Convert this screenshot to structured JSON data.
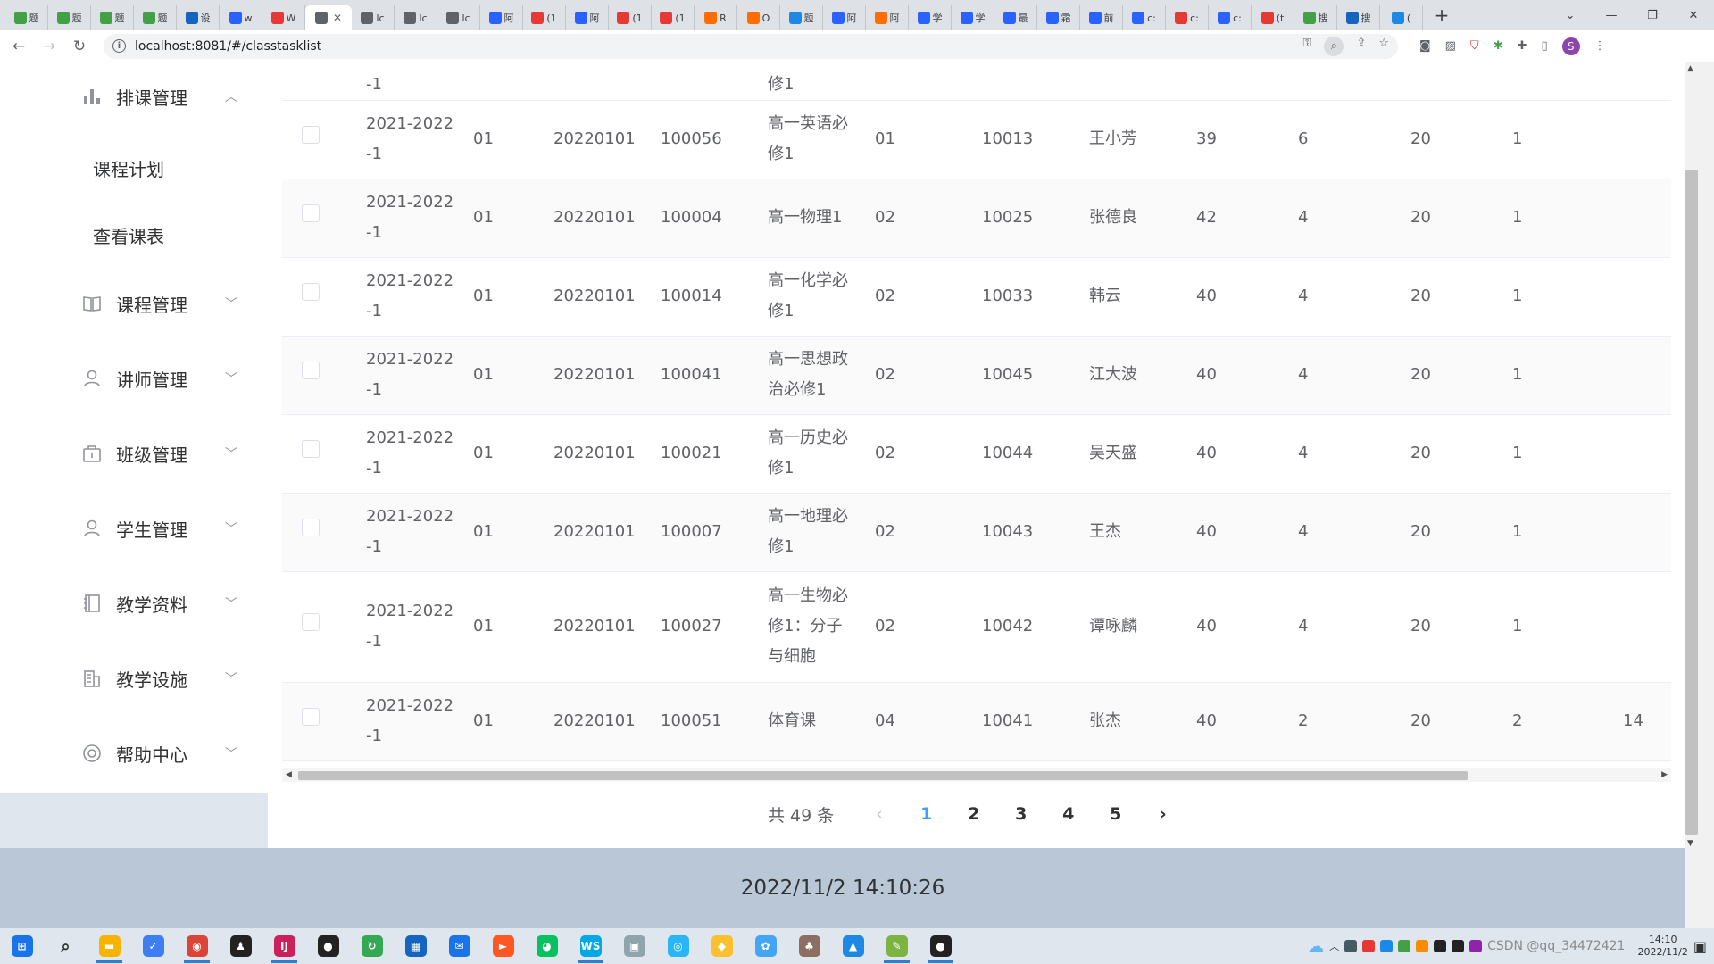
{
  "browser": {
    "tabs": [
      {
        "label": "题",
        "fav": "#43a047"
      },
      {
        "label": "题",
        "fav": "#43a047"
      },
      {
        "label": "题",
        "fav": "#43a047"
      },
      {
        "label": "题",
        "fav": "#43a047"
      },
      {
        "label": "设",
        "fav": "#1565c0"
      },
      {
        "label": "w",
        "fav": "#2962ff"
      },
      {
        "label": "W",
        "fav": "#e53935"
      },
      {
        "label": "",
        "fav": "#5f6368",
        "active": true
      },
      {
        "label": "lc",
        "fav": "#5f6368"
      },
      {
        "label": "lc",
        "fav": "#5f6368"
      },
      {
        "label": "lc",
        "fav": "#5f6368"
      },
      {
        "label": "阿",
        "fav": "#2962ff"
      },
      {
        "label": "(1",
        "fav": "#e53935"
      },
      {
        "label": "阿",
        "fav": "#2962ff"
      },
      {
        "label": "(1",
        "fav": "#e53935"
      },
      {
        "label": "(1",
        "fav": "#e53935"
      },
      {
        "label": "R",
        "fav": "#ff6d00"
      },
      {
        "label": "O",
        "fav": "#ff6d00"
      },
      {
        "label": "题",
        "fav": "#1e88e5"
      },
      {
        "label": "阿",
        "fav": "#2962ff"
      },
      {
        "label": "阿",
        "fav": "#ff6d00"
      },
      {
        "label": "学",
        "fav": "#2962ff"
      },
      {
        "label": "学",
        "fav": "#2962ff"
      },
      {
        "label": "最",
        "fav": "#2962ff"
      },
      {
        "label": "霜",
        "fav": "#2962ff"
      },
      {
        "label": "前",
        "fav": "#2962ff"
      },
      {
        "label": "c:",
        "fav": "#2962ff"
      },
      {
        "label": "c:",
        "fav": "#e53935"
      },
      {
        "label": "c:",
        "fav": "#2962ff"
      },
      {
        "label": "(t",
        "fav": "#e53935"
      },
      {
        "label": "搜",
        "fav": "#43a047"
      },
      {
        "label": "搜",
        "fav": "#1565c0"
      },
      {
        "label": "(",
        "fav": "#1e88e5"
      }
    ],
    "url": "localhost:8081/#/classtasklist",
    "profile_initial": "S"
  },
  "sidebar": {
    "group_open": {
      "label": "排课管理",
      "icon": "bar-chart-icon"
    },
    "subitems": [
      "课程计划",
      "查看课表"
    ],
    "groups": [
      {
        "label": "课程管理",
        "icon": "book-icon",
        "name": "course"
      },
      {
        "label": "讲师管理",
        "icon": "user-icon",
        "name": "teacher"
      },
      {
        "label": "班级管理",
        "icon": "suitcase-icon",
        "name": "class"
      },
      {
        "label": "学生管理",
        "icon": "user-icon",
        "name": "student"
      },
      {
        "label": "教学资料",
        "icon": "notebook-icon",
        "name": "materials"
      },
      {
        "label": "教学设施",
        "icon": "building-icon",
        "name": "facilities"
      },
      {
        "label": "帮助中心",
        "icon": "help-ring-icon",
        "name": "help"
      }
    ]
  },
  "table": {
    "partial_row": {
      "term_tail": "-1",
      "course_tail": "修1"
    },
    "rows": [
      {
        "term": [
          "2021-2022",
          "-1"
        ],
        "c1": "01",
        "c2": "20220101",
        "c3": "100056",
        "course": [
          "高一英语必",
          "修1"
        ],
        "c5": "01",
        "c6": "10013",
        "teacher": "王小芳",
        "c8": "39",
        "c9": "6",
        "c10": "20",
        "c11": "1",
        "c12": ""
      },
      {
        "term": [
          "2021-2022",
          "-1"
        ],
        "c1": "01",
        "c2": "20220101",
        "c3": "100004",
        "course": [
          "高一物理1"
        ],
        "c5": "02",
        "c6": "10025",
        "teacher": "张德良",
        "c8": "42",
        "c9": "4",
        "c10": "20",
        "c11": "1",
        "c12": ""
      },
      {
        "term": [
          "2021-2022",
          "-1"
        ],
        "c1": "01",
        "c2": "20220101",
        "c3": "100014",
        "course": [
          "高一化学必",
          "修1"
        ],
        "c5": "02",
        "c6": "10033",
        "teacher": "韩云",
        "c8": "40",
        "c9": "4",
        "c10": "20",
        "c11": "1",
        "c12": ""
      },
      {
        "term": [
          "2021-2022",
          "-1"
        ],
        "c1": "01",
        "c2": "20220101",
        "c3": "100041",
        "course": [
          "高一思想政",
          "治必修1"
        ],
        "c5": "02",
        "c6": "10045",
        "teacher": "江大波",
        "c8": "40",
        "c9": "4",
        "c10": "20",
        "c11": "1",
        "c12": ""
      },
      {
        "term": [
          "2021-2022",
          "-1"
        ],
        "c1": "01",
        "c2": "20220101",
        "c3": "100021",
        "course": [
          "高一历史必",
          "修1"
        ],
        "c5": "02",
        "c6": "10044",
        "teacher": "吴天盛",
        "c8": "40",
        "c9": "4",
        "c10": "20",
        "c11": "1",
        "c12": ""
      },
      {
        "term": [
          "2021-2022",
          "-1"
        ],
        "c1": "01",
        "c2": "20220101",
        "c3": "100007",
        "course": [
          "高一地理必",
          "修1"
        ],
        "c5": "02",
        "c6": "10043",
        "teacher": "王杰",
        "c8": "40",
        "c9": "4",
        "c10": "20",
        "c11": "1",
        "c12": ""
      },
      {
        "term": [
          "2021-2022",
          "-1"
        ],
        "c1": "01",
        "c2": "20220101",
        "c3": "100027",
        "course": [
          "高一生物必",
          "修1：分子",
          "与细胞"
        ],
        "c5": "02",
        "c6": "10042",
        "teacher": "谭咏麟",
        "c8": "40",
        "c9": "4",
        "c10": "20",
        "c11": "1",
        "c12": ""
      },
      {
        "term": [
          "2021-2022",
          "-1"
        ],
        "c1": "01",
        "c2": "20220101",
        "c3": "100051",
        "course": [
          "体育课"
        ],
        "c5": "04",
        "c6": "10041",
        "teacher": "张杰",
        "c8": "40",
        "c9": "2",
        "c10": "20",
        "c11": "2",
        "c12": "14"
      }
    ]
  },
  "pagination": {
    "total_text": "共 49 条",
    "pages": [
      "1",
      "2",
      "3",
      "4",
      "5"
    ],
    "current": "1",
    "prev": "‹",
    "next": "›"
  },
  "footer": {
    "datetime": "2022/11/2 14:10:26"
  },
  "taskbar": {
    "apps": [
      {
        "name": "start",
        "color": "#1a73e8",
        "glyph": "⊞",
        "run": false
      },
      {
        "name": "search",
        "color": "#dfe6ee",
        "glyph": "⌕",
        "run": false
      },
      {
        "name": "file-explorer",
        "color": "#f6b400",
        "glyph": "▬",
        "run": true
      },
      {
        "name": "app-blue",
        "color": "#3d7ef0",
        "glyph": "✓",
        "run": false
      },
      {
        "name": "chrome",
        "color": "#db4437",
        "glyph": "◉",
        "run": true
      },
      {
        "name": "qq",
        "color": "#222",
        "glyph": "♟",
        "run": false
      },
      {
        "name": "intellij",
        "color": "#cc1f5b",
        "glyph": "IJ",
        "run": true
      },
      {
        "name": "recorder",
        "color": "#222",
        "glyph": "●",
        "run": false
      },
      {
        "name": "refresh-app",
        "color": "#34a853",
        "glyph": "↻",
        "run": false
      },
      {
        "name": "store",
        "color": "#1565c0",
        "glyph": "▦",
        "run": false
      },
      {
        "name": "mail",
        "color": "#1a73e8",
        "glyph": "✉",
        "run": false
      },
      {
        "name": "app-orange",
        "color": "#ff5722",
        "glyph": "►",
        "run": false
      },
      {
        "name": "wechat",
        "color": "#07c160",
        "glyph": "◕",
        "run": false
      },
      {
        "name": "webstorm",
        "color": "#00a8e8",
        "glyph": "WS",
        "run": true
      },
      {
        "name": "photos",
        "color": "#90a4ae",
        "glyph": "▣",
        "run": false
      },
      {
        "name": "browser-2",
        "color": "#29b6f6",
        "glyph": "◎",
        "run": false
      },
      {
        "name": "app-yellow",
        "color": "#fbc02d",
        "glyph": "◆",
        "run": false
      },
      {
        "name": "app-cloud",
        "color": "#42a5f5",
        "glyph": "✿",
        "run": false
      },
      {
        "name": "app-pink",
        "color": "#8d6e63",
        "glyph": "♣",
        "run": false
      },
      {
        "name": "pictures",
        "color": "#1e88e5",
        "glyph": "▲",
        "run": false
      },
      {
        "name": "notepad",
        "color": "#7cb342",
        "glyph": "✎",
        "run": true
      },
      {
        "name": "recorder-2",
        "color": "#222",
        "glyph": "●",
        "run": true
      }
    ],
    "tray_text": "CSDN @qq_34472421",
    "time": "14:10",
    "date": "2022/11/2"
  }
}
